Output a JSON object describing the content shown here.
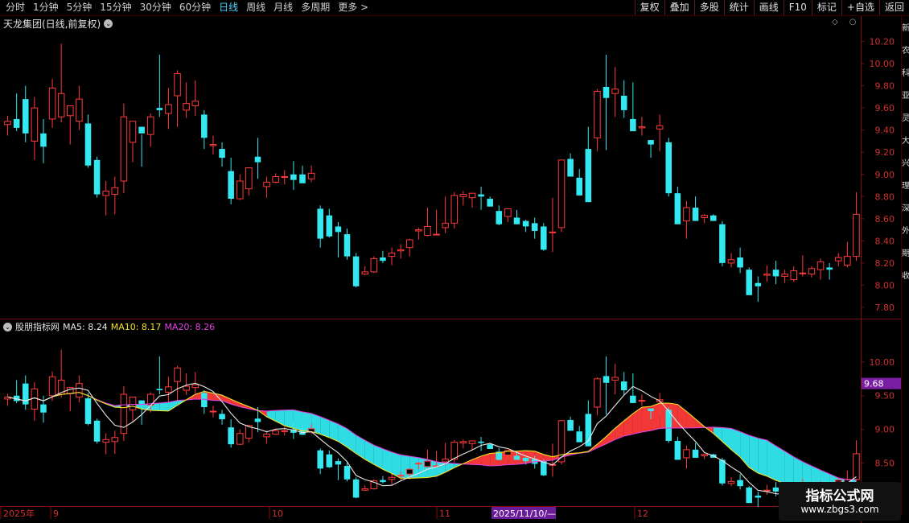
{
  "toolbar": {
    "periods": [
      "分时",
      "1分钟",
      "5分钟",
      "15分钟",
      "30分钟",
      "60分钟",
      "日线",
      "周线",
      "月线",
      "多周期",
      "更多 >"
    ],
    "active_period": "日线",
    "right_buttons": [
      "复权",
      "叠加",
      "多股",
      "统计",
      "画线",
      "F10",
      "标记",
      "+自选",
      "返回"
    ]
  },
  "stock": {
    "title": "天龙集团(日线,前复权)"
  },
  "indicator": {
    "name": "股朋指标网",
    "ma5_label": "MA5: 8.24",
    "ma10_label": "MA10: 8.17",
    "ma20_label": "MA20: 8.26"
  },
  "price_axis": [
    "10.20",
    "10.00",
    "9.80",
    "9.60",
    "9.40",
    "9.20",
    "9.00",
    "8.80",
    "8.60",
    "8.40",
    "8.20",
    "8.00",
    "7.80"
  ],
  "ind_axis": [
    "10.00",
    "9.50",
    "9.00",
    "8.50"
  ],
  "current_marker": "9.68",
  "date_axis": {
    "labels": [
      "2025年",
      "9",
      "10",
      "11",
      "2025/11/10/—",
      "12"
    ]
  },
  "side_text": [
    "新",
    "农",
    "科",
    "亚",
    "灵",
    "大",
    "兴",
    "理",
    "深",
    "外",
    "期",
    "收"
  ],
  "colors": {
    "up": "#ff3a3a",
    "down": "#33e8f0",
    "ma5": "#e8e8e8",
    "ma10": "#f0e020",
    "ma20": "#e040e0",
    "bg": "#000000",
    "grid": "#3a0000"
  },
  "watermark": {
    "main": "指标公式网",
    "sub": "www.zbgs3.com"
  },
  "chart_data": {
    "type": "candlestick",
    "title": "天龙集团(日线,前复权)",
    "ylim": [
      7.72,
      10.32
    ],
    "candles": [
      [
        9.45,
        9.53,
        9.35,
        9.48
      ],
      [
        9.5,
        9.73,
        9.39,
        9.42
      ],
      [
        9.68,
        9.8,
        9.29,
        9.37
      ],
      [
        9.3,
        9.7,
        9.13,
        9.6
      ],
      [
        9.37,
        9.5,
        9.1,
        9.25
      ],
      [
        9.5,
        9.86,
        9.42,
        9.78
      ],
      [
        9.52,
        10.18,
        9.47,
        9.73
      ],
      [
        9.53,
        9.62,
        9.27,
        9.62
      ],
      [
        9.48,
        9.8,
        9.4,
        9.68
      ],
      [
        9.46,
        9.54,
        9.06,
        9.08
      ],
      [
        9.13,
        9.16,
        8.79,
        8.82
      ],
      [
        8.81,
        8.94,
        8.63,
        8.85
      ],
      [
        8.82,
        8.98,
        8.64,
        8.88
      ],
      [
        8.94,
        9.64,
        8.83,
        9.52
      ],
      [
        9.29,
        9.48,
        9.11,
        9.48
      ],
      [
        9.43,
        9.36,
        9.07,
        9.37
      ],
      [
        9.36,
        9.55,
        9.25,
        9.52
      ],
      [
        9.6,
        10.08,
        9.52,
        9.58
      ],
      [
        9.55,
        9.78,
        9.41,
        9.63
      ],
      [
        9.71,
        9.94,
        9.43,
        9.91
      ],
      [
        9.58,
        9.83,
        9.51,
        9.64
      ],
      [
        9.62,
        9.85,
        9.53,
        9.66
      ],
      [
        9.54,
        9.58,
        9.23,
        9.33
      ],
      [
        9.26,
        9.35,
        9.18,
        9.27
      ],
      [
        9.23,
        9.29,
        9.07,
        9.15
      ],
      [
        9.03,
        9.15,
        8.73,
        8.78
      ],
      [
        8.78,
        9.0,
        8.77,
        8.94
      ],
      [
        8.87,
        9.06,
        8.81,
        9.06
      ],
      [
        9.16,
        9.33,
        8.96,
        9.11
      ],
      [
        8.89,
        8.98,
        8.79,
        8.93
      ],
      [
        8.93,
        9.01,
        8.92,
        8.98
      ],
      [
        8.98,
        9.04,
        8.91,
        8.98
      ],
      [
        9.0,
        9.12,
        8.86,
        8.95
      ],
      [
        9.0,
        9.08,
        8.92,
        8.92
      ],
      [
        8.96,
        9.08,
        8.93,
        9.01
      ],
      [
        8.69,
        8.72,
        8.34,
        8.42
      ],
      [
        8.63,
        8.69,
        8.43,
        8.44
      ],
      [
        8.53,
        8.57,
        8.25,
        8.48
      ],
      [
        8.46,
        8.51,
        8.23,
        8.26
      ],
      [
        8.26,
        8.29,
        7.98,
        7.99
      ],
      [
        8.1,
        8.17,
        8.09,
        8.12
      ],
      [
        8.12,
        8.26,
        8.11,
        8.24
      ],
      [
        8.25,
        8.31,
        8.2,
        8.22
      ],
      [
        8.26,
        8.34,
        8.18,
        8.29
      ],
      [
        8.31,
        8.37,
        8.24,
        8.32
      ],
      [
        8.34,
        8.42,
        8.26,
        8.41
      ],
      [
        8.49,
        8.52,
        8.41,
        8.5
      ],
      [
        8.45,
        8.7,
        8.44,
        8.53
      ],
      [
        8.46,
        8.68,
        8.45,
        8.46
      ],
      [
        8.52,
        8.8,
        8.47,
        8.56
      ],
      [
        8.56,
        8.84,
        8.51,
        8.81
      ],
      [
        8.8,
        8.85,
        8.72,
        8.82
      ],
      [
        8.79,
        8.83,
        8.7,
        8.83
      ],
      [
        8.82,
        8.89,
        8.68,
        8.8
      ],
      [
        8.78,
        8.8,
        8.71,
        8.71
      ],
      [
        8.67,
        8.72,
        8.54,
        8.55
      ],
      [
        8.62,
        8.69,
        8.57,
        8.69
      ],
      [
        8.61,
        8.68,
        8.55,
        8.55
      ],
      [
        8.58,
        8.59,
        8.48,
        8.53
      ],
      [
        8.56,
        8.61,
        8.42,
        8.49
      ],
      [
        8.53,
        8.56,
        8.31,
        8.32
      ],
      [
        8.48,
        8.79,
        8.3,
        8.48
      ],
      [
        8.52,
        9.02,
        8.48,
        9.13
      ],
      [
        9.14,
        9.19,
        8.99,
        8.98
      ],
      [
        8.97,
        9.05,
        8.83,
        8.81
      ],
      [
        9.23,
        9.43,
        8.77,
        8.75
      ],
      [
        9.33,
        9.77,
        9.21,
        9.75
      ],
      [
        9.79,
        10.08,
        9.22,
        9.69
      ],
      [
        9.73,
        9.97,
        9.52,
        9.77
      ],
      [
        9.71,
        9.85,
        9.51,
        9.58
      ],
      [
        9.5,
        9.83,
        9.44,
        9.39
      ],
      [
        9.42,
        9.52,
        9.35,
        9.43
      ],
      [
        9.31,
        9.28,
        9.15,
        9.27
      ],
      [
        9.41,
        9.54,
        9.21,
        9.44
      ],
      [
        9.29,
        9.33,
        8.8,
        8.83
      ],
      [
        8.83,
        8.89,
        8.58,
        8.55
      ],
      [
        8.58,
        8.76,
        8.42,
        8.7
      ],
      [
        8.7,
        8.8,
        8.7,
        8.58
      ],
      [
        8.61,
        8.64,
        8.56,
        8.63
      ],
      [
        8.63,
        8.64,
        8.58,
        8.58
      ],
      [
        8.55,
        8.58,
        8.17,
        8.2
      ],
      [
        8.2,
        8.29,
        8.16,
        8.23
      ],
      [
        8.25,
        8.34,
        8.11,
        8.16
      ],
      [
        8.14,
        8.16,
        7.99,
        7.91
      ],
      [
        8.02,
        8.08,
        7.85,
        7.99
      ],
      [
        8.09,
        8.18,
        8.03,
        8.1
      ],
      [
        8.14,
        8.22,
        8.01,
        8.08
      ],
      [
        8.08,
        8.14,
        8.02,
        8.1
      ],
      [
        8.05,
        8.17,
        8.03,
        8.13
      ],
      [
        8.11,
        8.27,
        8.08,
        8.11
      ],
      [
        8.1,
        8.17,
        8.07,
        8.15
      ],
      [
        8.14,
        8.24,
        8.05,
        8.21
      ],
      [
        8.16,
        8.2,
        8.05,
        8.14
      ],
      [
        8.22,
        8.29,
        8.17,
        8.25
      ],
      [
        8.18,
        8.39,
        8.16,
        8.26
      ],
      [
        8.26,
        8.84,
        8.22,
        8.64
      ]
    ]
  }
}
